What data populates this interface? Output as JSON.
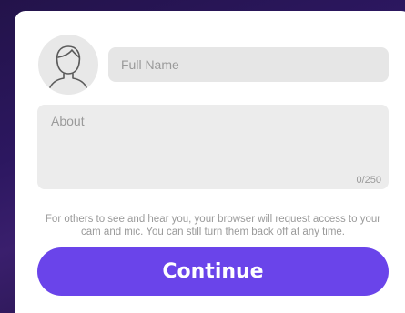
{
  "profile": {
    "avatar_icon": "person-silhouette-icon",
    "name_placeholder": "Full Name",
    "name_value": "",
    "about_placeholder": "About",
    "about_value": "",
    "about_counter": "0/250"
  },
  "notice_text": "For others to see and hear you, your browser will request access to your cam and mic. You can still turn them back off at any time.",
  "continue_label": "Continue",
  "colors": {
    "accent": "#6a44ea",
    "field_bg": "#e6e6e6",
    "muted_text": "#9a9a9a"
  }
}
